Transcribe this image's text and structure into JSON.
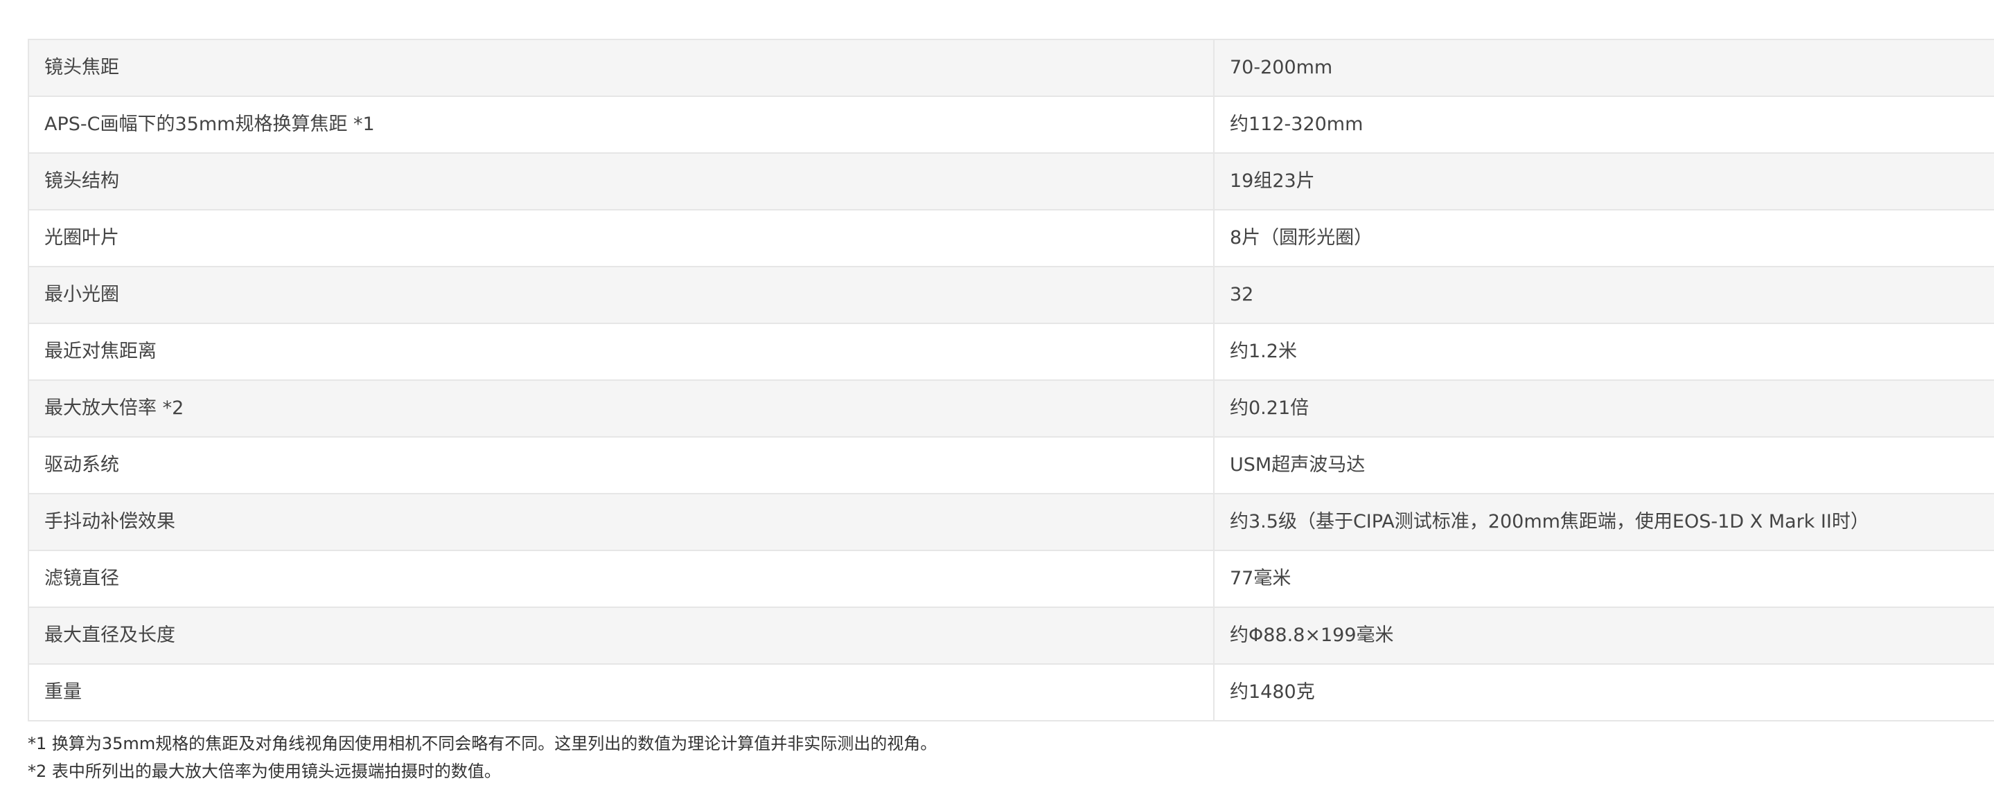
{
  "spec_table": {
    "rows": [
      {
        "label": "镜头焦距",
        "value": "70-200mm"
      },
      {
        "label": "APS-C画幅下的35mm规格换算焦距 *1",
        "value": "约112-320mm"
      },
      {
        "label": "镜头结构",
        "value": "19组23片"
      },
      {
        "label": "光圈叶片",
        "value": "8片（圆形光圈）"
      },
      {
        "label": "最小光圈",
        "value": "32"
      },
      {
        "label": "最近对焦距离",
        "value": "约1.2米"
      },
      {
        "label": "最大放大倍率 *2",
        "value": "约0.21倍"
      },
      {
        "label": "驱动系统",
        "value": "USM超声波马达"
      },
      {
        "label": "手抖动补偿效果",
        "value": "约3.5级（基于CIPA测试标准，200mm焦距端，使用EOS-1D X Mark II时）"
      },
      {
        "label": "滤镜直径",
        "value": "77毫米"
      },
      {
        "label": "最大直径及长度",
        "value": "约Φ88.8×199毫米"
      },
      {
        "label": "重量",
        "value": "约1480克"
      }
    ]
  },
  "footnotes": [
    "*1 换算为35mm规格的焦距及对角线视角因使用相机不同会略有不同。这里列出的数值为理论计算值并非实际测出的视角。",
    "*2 表中所列出的最大放大倍率为使用镜头远摄端拍摄时的数值。"
  ]
}
